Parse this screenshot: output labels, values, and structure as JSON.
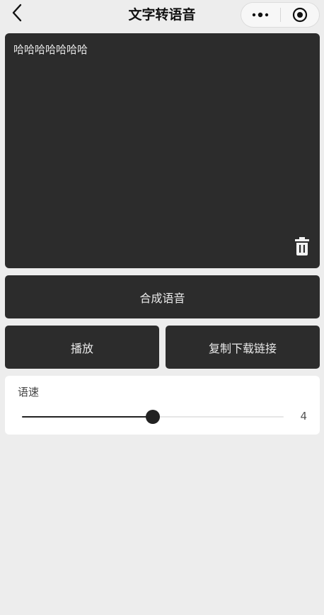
{
  "navbar": {
    "title": "文字转语音",
    "back_icon": "chevron-left-icon",
    "more_icon": "more-dots-icon",
    "close_icon": "target-circle-icon"
  },
  "editor": {
    "text": "哈哈哈哈哈哈哈",
    "delete_icon": "trash-icon"
  },
  "actions": {
    "synthesize_label": "合成语音",
    "play_label": "播放",
    "copy_link_label": "复制下载链接"
  },
  "speed": {
    "label": "语速",
    "value": "4",
    "fraction": 0.5
  },
  "colors": {
    "panel": "#2c2c2c",
    "background": "#ededed",
    "card": "#ffffff"
  }
}
